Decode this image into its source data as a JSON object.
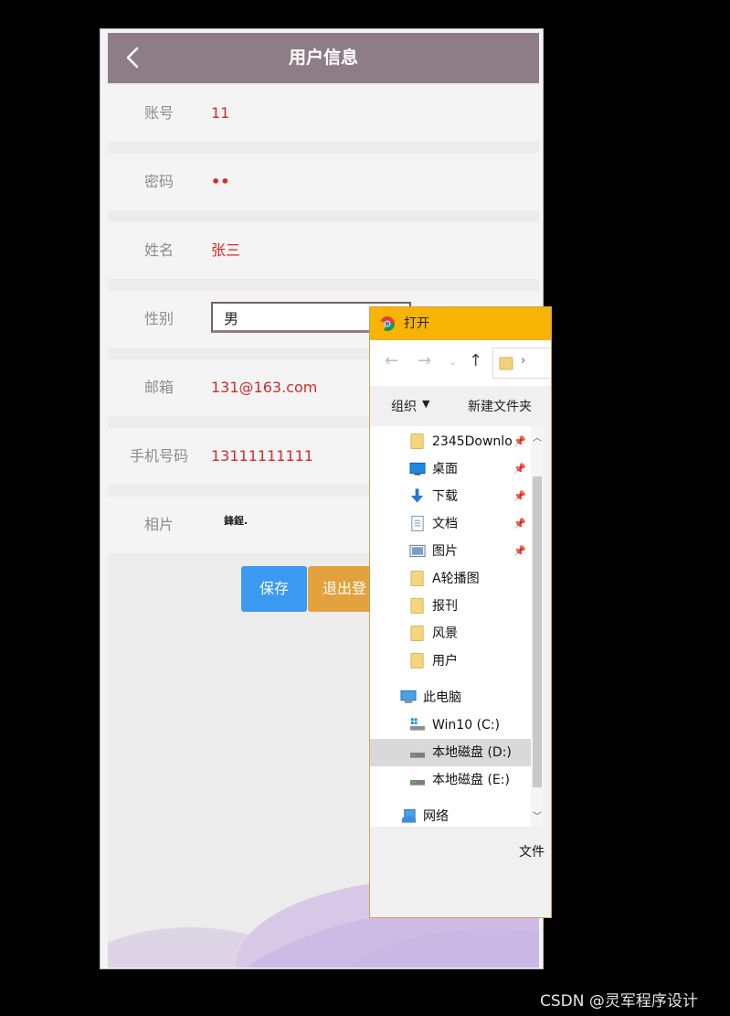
{
  "header": {
    "title": "用户信息",
    "back_icon": "chevron-left-icon"
  },
  "form": {
    "account_label": "账号",
    "account_value": "11",
    "password_label": "密码",
    "password_value": "••",
    "name_label": "姓名",
    "name_value": "张三",
    "gender_label": "性别",
    "gender_value": "男",
    "email_label": "邮箱",
    "email_value": "131@163.com",
    "phone_label": "手机号码",
    "phone_value": "13111111111",
    "photo_label": "相片",
    "photo_value": "鋒鋥."
  },
  "buttons": {
    "save": "保存",
    "logout": "退出登"
  },
  "dialog": {
    "title": "打开",
    "organize": "组织",
    "new_folder": "新建文件夹",
    "address_crumb": "›",
    "tree": [
      {
        "label": "2345Downlo",
        "icon": "folder-icon",
        "pinned": true
      },
      {
        "label": "桌面",
        "icon": "desktop-icon",
        "pinned": true
      },
      {
        "label": "下载",
        "icon": "download-icon",
        "pinned": true
      },
      {
        "label": "文档",
        "icon": "document-icon",
        "pinned": true
      },
      {
        "label": "图片",
        "icon": "picture-icon",
        "pinned": true
      },
      {
        "label": "A轮播图",
        "icon": "folder-icon",
        "pinned": false
      },
      {
        "label": "报刊",
        "icon": "folder-icon",
        "pinned": false
      },
      {
        "label": "风景",
        "icon": "folder-icon",
        "pinned": false
      },
      {
        "label": "用户",
        "icon": "folder-icon",
        "pinned": false
      },
      {
        "label": "此电脑",
        "icon": "computer-icon",
        "pinned": false
      },
      {
        "label": "Win10 (C:)",
        "icon": "windows-drive-icon",
        "pinned": false
      },
      {
        "label": "本地磁盘 (D:)",
        "icon": "drive-icon",
        "pinned": false,
        "selected": true
      },
      {
        "label": "本地磁盘 (E:)",
        "icon": "drive-icon",
        "pinned": false
      },
      {
        "label": "网络",
        "icon": "network-icon",
        "pinned": false
      }
    ],
    "file_label": "文件"
  },
  "watermark": "CSDN @灵军程序设计",
  "colors": {
    "header": "#8e7d87",
    "value_text": "#d12b2b",
    "save": "#3a9af2",
    "logout": "#e2a23d",
    "dialog_title": "#f7b404"
  }
}
